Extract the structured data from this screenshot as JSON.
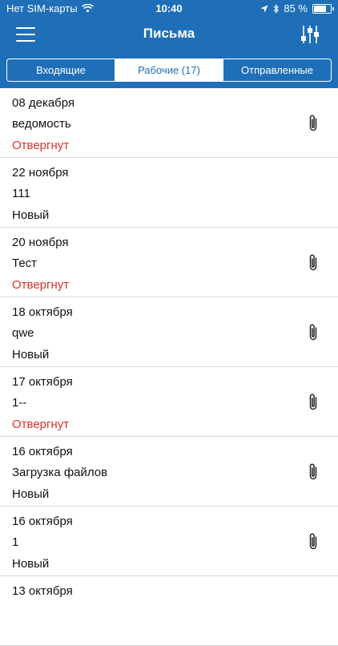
{
  "statusbar": {
    "carrier": "Нет SIM-карты",
    "time": "10:40",
    "battery_text": "85 %",
    "battery_level": 0.85
  },
  "navbar": {
    "title": "Письма",
    "menu_icon": "hamburger-menu-icon",
    "filter_icon": "sliders-filter-icon"
  },
  "tabs": [
    {
      "label": "Входящие",
      "active": false
    },
    {
      "label": "Рабочие (17)",
      "active": true
    },
    {
      "label": "Отправленные",
      "active": false
    }
  ],
  "colors": {
    "accent": "#1f6fb8",
    "rejected": "#d9302c"
  },
  "messages": [
    {
      "date": "08 декабря",
      "subject": "ведомость",
      "status": "Отвергнут",
      "status_type": "rejected",
      "attachment": true
    },
    {
      "date": "22 ноября",
      "subject": "111",
      "status": "Новый",
      "status_type": "new",
      "attachment": false
    },
    {
      "date": "20 ноября",
      "subject": "Тест",
      "status": "Отвергнут",
      "status_type": "rejected",
      "attachment": true
    },
    {
      "date": "18 октября",
      "subject": "qwe",
      "status": "Новый",
      "status_type": "new",
      "attachment": true
    },
    {
      "date": "17 октября",
      "subject": "1--",
      "status": "Отвергнут",
      "status_type": "rejected",
      "attachment": true
    },
    {
      "date": "16 октября",
      "subject": "Загрузка файлов",
      "status": "Новый",
      "status_type": "new",
      "attachment": true
    },
    {
      "date": "16 октября",
      "subject": "1",
      "status": "Новый",
      "status_type": "new",
      "attachment": true
    },
    {
      "date": "13 октября",
      "subject": "",
      "status": "",
      "status_type": "new",
      "attachment": false
    }
  ]
}
